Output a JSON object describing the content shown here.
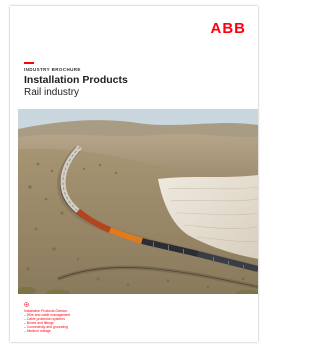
{
  "brand": {
    "logo_text": "ABB",
    "accent_color": "#ff000f"
  },
  "header": {
    "eyebrow": "INDUSTRY BROCHURE",
    "title": "Installation Products",
    "subtitle": "Rail industry"
  },
  "image": {
    "subject": "freight-train-curve-photo"
  },
  "footer": {
    "icon": "circle-plus-icon",
    "items": [
      "Installation Products Division",
      "– Wire and cable management",
      "– Cable protection systems",
      "– Boxes and fittings",
      "– Connectivity and grounding",
      "– Medium voltage"
    ]
  }
}
